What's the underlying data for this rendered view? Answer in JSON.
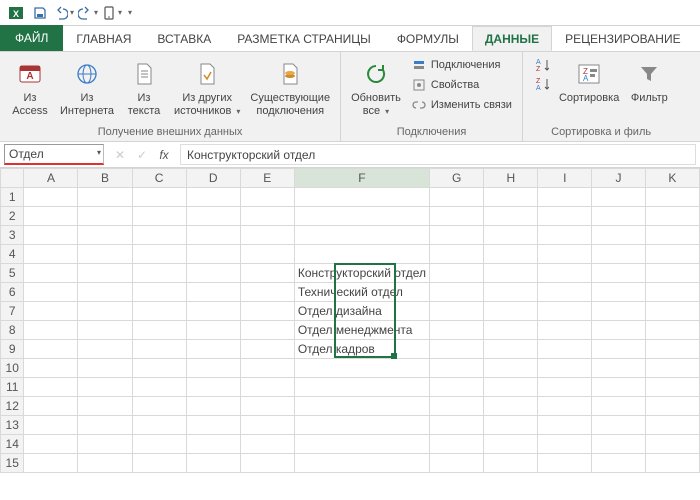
{
  "qat_icons": [
    "excel-icon",
    "save-icon",
    "undo-icon",
    "redo-icon",
    "touch-icon"
  ],
  "tabs": {
    "file": "ФАЙЛ",
    "items": [
      "ГЛАВНАЯ",
      "ВСТАВКА",
      "РАЗМЕТКА СТРАНИЦЫ",
      "ФОРМУЛЫ",
      "ДАННЫЕ",
      "РЕЦЕНЗИРОВАНИЕ"
    ],
    "active_index": 4
  },
  "ribbon": {
    "group1": {
      "title": "Получение внешних данных",
      "btns": {
        "access": {
          "l1": "Из",
          "l2": "Access"
        },
        "web": {
          "l1": "Из",
          "l2": "Интернета"
        },
        "text": {
          "l1": "Из",
          "l2": "текста"
        },
        "other": {
          "l1": "Из других",
          "l2": "источников"
        },
        "conn": {
          "l1": "Существующие",
          "l2": "подключения"
        }
      }
    },
    "group2": {
      "title": "Подключения",
      "refresh": {
        "l1": "Обновить",
        "l2": "все"
      },
      "s1": "Подключения",
      "s2": "Свойства",
      "s3": "Изменить связи"
    },
    "group3": {
      "title": "Сортировка и филь",
      "sortaz": "",
      "sort": "Сортировка",
      "filter": "Фильтр"
    }
  },
  "namebox": "Отдел",
  "formula": "Конструкторский отдел",
  "columns": [
    "A",
    "B",
    "C",
    "D",
    "E",
    "F",
    "G",
    "H",
    "I",
    "J",
    "K"
  ],
  "rows": 15,
  "sel": {
    "rows": [
      5,
      6,
      7,
      8,
      9
    ],
    "col": "F"
  },
  "cells": {
    "F5": "Конструкторский отдел",
    "F6": "Технический отдел",
    "F7": "Отдел дизайна",
    "F8": "Отдел менеджмента",
    "F9": "Отдел кадров"
  },
  "colors": {
    "accent": "#217346"
  }
}
